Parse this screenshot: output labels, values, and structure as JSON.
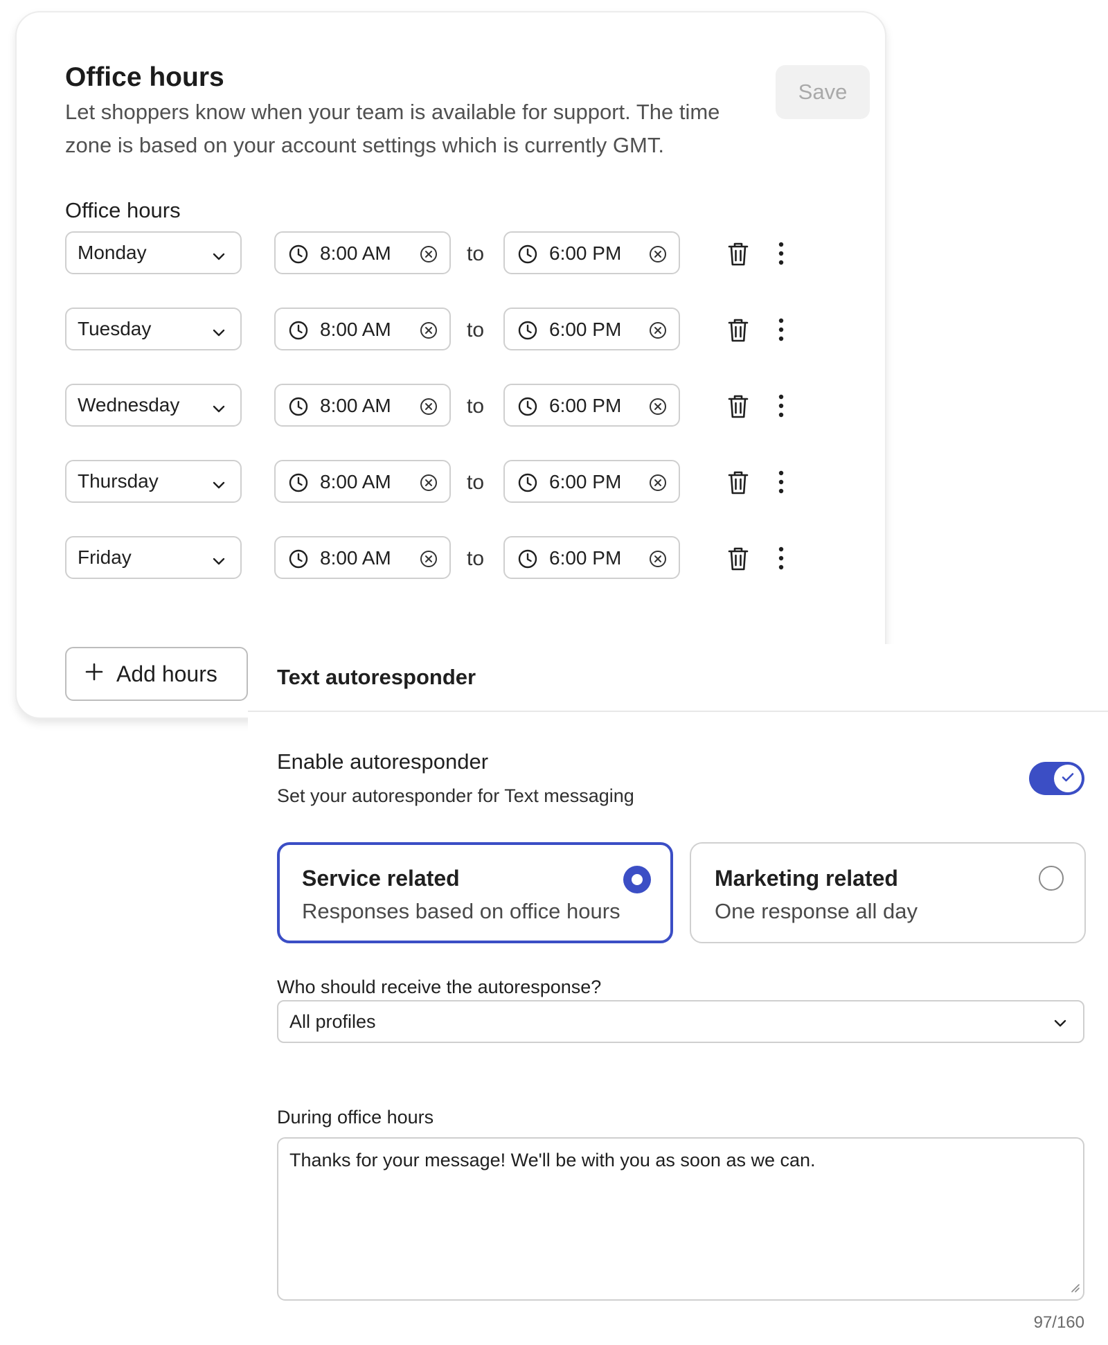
{
  "office_hours": {
    "title": "Office hours",
    "description": "Let shoppers know when your team is available for support. The time zone is based on your account settings which is currently GMT.",
    "save_label": "Save",
    "section_label": "Office hours",
    "rows": [
      {
        "day": "Monday",
        "start": "8:00 AM",
        "end": "6:00 PM"
      },
      {
        "day": "Tuesday",
        "start": "8:00 AM",
        "end": "6:00 PM"
      },
      {
        "day": "Wednesday",
        "start": "8:00 AM",
        "end": "6:00 PM"
      },
      {
        "day": "Thursday",
        "start": "8:00 AM",
        "end": "6:00 PM"
      },
      {
        "day": "Friday",
        "start": "8:00 AM",
        "end": "6:00 PM"
      }
    ],
    "to_label": "to",
    "add_hours_label": "Add hours"
  },
  "autoresponder": {
    "title": "Text autoresponder",
    "enable_title": "Enable autoresponder",
    "enable_subtitle": "Set your autoresponder for Text messaging",
    "enabled": true,
    "options": [
      {
        "title": "Service related",
        "subtitle": "Responses based on office hours",
        "selected": true
      },
      {
        "title": "Marketing related",
        "subtitle": "One response all day",
        "selected": false
      }
    ],
    "recipient_label": "Who should receive the autoresponse?",
    "recipient_value": "All profiles",
    "during_label": "During office hours",
    "message": "Thanks for your message! We'll be with you as soon as we can.",
    "char_count": "97/160"
  },
  "colors": {
    "accent": "#3b4ec5",
    "border": "#cfcfcf",
    "muted_text": "#505050"
  },
  "icons": [
    "clock-icon",
    "clear-icon",
    "chevron-down-icon",
    "trash-icon",
    "more-vertical-icon",
    "plus-icon",
    "check-icon"
  ]
}
